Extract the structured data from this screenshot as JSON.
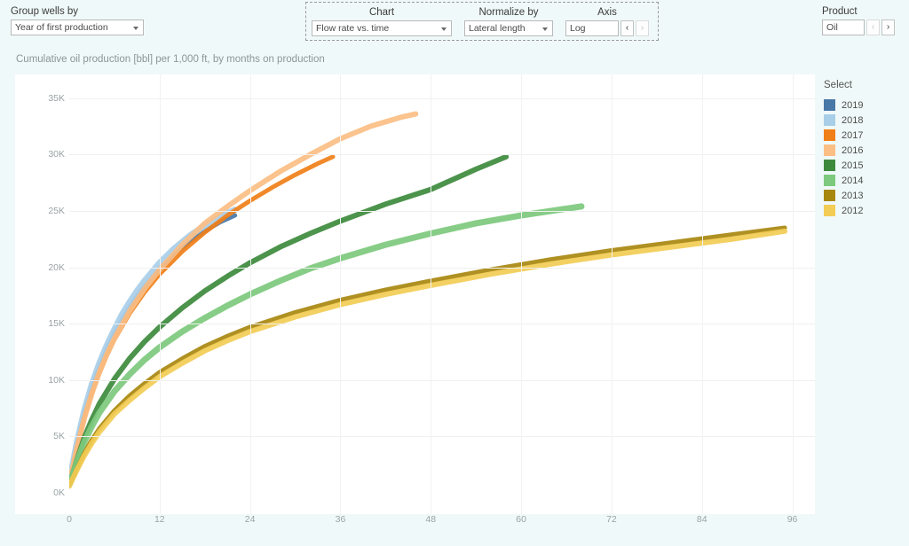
{
  "header": {
    "group_wells": {
      "label": "Group wells by",
      "value": "Year of first production"
    },
    "center_panel": {
      "chart": {
        "label": "Chart",
        "value": "Flow rate vs. time"
      },
      "normalize": {
        "label": "Normalize by",
        "value": "Lateral length"
      },
      "axis": {
        "label": "Axis",
        "value": "Log",
        "prev": "‹",
        "next": "›"
      }
    },
    "product": {
      "label": "Product",
      "value": "Oil",
      "prev": "‹",
      "next": "›"
    }
  },
  "legend": {
    "title": "Select",
    "items": [
      {
        "label": "2019",
        "color": "#4878a8"
      },
      {
        "label": "2018",
        "color": "#a8cee8"
      },
      {
        "label": "2017",
        "color": "#f07f18"
      },
      {
        "label": "2016",
        "color": "#fbbe84"
      },
      {
        "label": "2015",
        "color": "#3d8a3d"
      },
      {
        "label": "2014",
        "color": "#7dc97d"
      },
      {
        "label": "2013",
        "color": "#a8870f"
      },
      {
        "label": "2012",
        "color": "#f2cc55"
      }
    ]
  },
  "chart_data": {
    "type": "line",
    "title": "Cumulative oil production [bbl] per 1,000 ft, by months on production",
    "xlabel": "",
    "ylabel": "",
    "xlim": [
      0,
      99
    ],
    "ylim": [
      0,
      36000
    ],
    "grid": true,
    "legend_position": "right",
    "xticks": [
      0,
      12,
      24,
      36,
      48,
      60,
      72,
      84,
      96
    ],
    "xtick_labels": [
      "0",
      "12",
      "24",
      "36",
      "48",
      "60",
      "72",
      "84",
      "96"
    ],
    "yticks": [
      0,
      5000,
      10000,
      15000,
      20000,
      25000,
      30000,
      35000
    ],
    "ytick_labels": [
      "0K",
      "5K",
      "10K",
      "15K",
      "20K",
      "25K",
      "30K",
      "35K"
    ],
    "x_unit": "months on production",
    "y_unit": "bbl per 1,000 ft",
    "series": [
      {
        "name": "2019",
        "color": "#4878a8",
        "band_width": 5,
        "x": [
          0,
          1,
          2,
          3,
          4,
          5,
          6,
          7,
          8,
          9,
          10,
          12,
          14,
          16,
          18,
          20,
          22
        ],
        "y": [
          900,
          4200,
          7000,
          9200,
          11100,
          12700,
          14100,
          15300,
          16400,
          17400,
          18300,
          19900,
          21200,
          22300,
          23200,
          24000,
          24600
        ]
      },
      {
        "name": "2018",
        "color": "#a8cee8",
        "band_width": 7,
        "x": [
          0,
          1,
          2,
          3,
          4,
          5,
          6,
          7,
          8,
          9,
          10,
          12,
          14,
          16,
          18,
          20,
          22
        ],
        "y": [
          950,
          4400,
          7300,
          9600,
          11500,
          13100,
          14500,
          15800,
          16900,
          17900,
          18800,
          20400,
          21700,
          22800,
          23700,
          24500,
          25100
        ]
      },
      {
        "name": "2017",
        "color": "#f07f18",
        "band_width": 5,
        "x": [
          0,
          1,
          2,
          3,
          4,
          5,
          6,
          8,
          10,
          12,
          15,
          18,
          21,
          24,
          27,
          30,
          33,
          35
        ],
        "y": [
          800,
          3900,
          6600,
          8800,
          10600,
          12200,
          13600,
          15900,
          17800,
          19400,
          21400,
          23100,
          24600,
          25900,
          27100,
          28200,
          29200,
          29800
        ]
      },
      {
        "name": "2016",
        "color": "#fbbe84",
        "band_width": 6,
        "x": [
          0,
          1,
          2,
          3,
          4,
          5,
          6,
          8,
          10,
          12,
          15,
          18,
          21,
          24,
          28,
          32,
          36,
          40,
          44,
          46
        ],
        "y": [
          800,
          3900,
          6600,
          8800,
          10700,
          12300,
          13700,
          16100,
          18100,
          19800,
          22000,
          23900,
          25400,
          26800,
          28500,
          30000,
          31400,
          32500,
          33300,
          33600
        ]
      },
      {
        "name": "2015",
        "color": "#3d8a3d",
        "band_width": 6,
        "x": [
          0,
          1,
          2,
          3,
          4,
          6,
          8,
          10,
          12,
          15,
          18,
          21,
          24,
          28,
          32,
          36,
          42,
          48,
          54,
          58
        ],
        "y": [
          700,
          2900,
          4900,
          6500,
          7900,
          10100,
          11900,
          13400,
          14700,
          16400,
          17900,
          19200,
          20400,
          21800,
          23000,
          24100,
          25600,
          26900,
          28700,
          29800
        ]
      },
      {
        "name": "2014",
        "color": "#7dc97d",
        "band_width": 7,
        "x": [
          0,
          1,
          2,
          3,
          4,
          6,
          8,
          10,
          12,
          15,
          18,
          21,
          24,
          28,
          32,
          36,
          42,
          48,
          54,
          60,
          66,
          68
        ],
        "y": [
          700,
          2700,
          4500,
          5900,
          7100,
          9000,
          10500,
          11800,
          12900,
          14300,
          15500,
          16600,
          17600,
          18800,
          19900,
          20800,
          22000,
          23000,
          23900,
          24600,
          25200,
          25400
        ]
      },
      {
        "name": "2013",
        "color": "#a8870f",
        "band_width": 5,
        "x": [
          0,
          1,
          2,
          3,
          4,
          6,
          8,
          10,
          12,
          15,
          18,
          21,
          24,
          30,
          36,
          42,
          48,
          56,
          64,
          72,
          80,
          88,
          95
        ],
        "y": [
          600,
          2100,
          3500,
          4700,
          5700,
          7300,
          8600,
          9700,
          10700,
          11900,
          13000,
          13900,
          14700,
          16000,
          17100,
          18000,
          18800,
          19800,
          20700,
          21500,
          22200,
          22900,
          23500
        ]
      },
      {
        "name": "2012",
        "color": "#f2cc55",
        "band_width": 6,
        "x": [
          0,
          1,
          2,
          3,
          4,
          6,
          8,
          10,
          12,
          15,
          18,
          21,
          24,
          30,
          36,
          42,
          48,
          56,
          64,
          72,
          80,
          88,
          95
        ],
        "y": [
          600,
          2000,
          3300,
          4400,
          5400,
          7000,
          8200,
          9300,
          10300,
          11500,
          12600,
          13500,
          14300,
          15600,
          16700,
          17600,
          18400,
          19400,
          20300,
          21100,
          21800,
          22500,
          23200
        ]
      }
    ]
  }
}
